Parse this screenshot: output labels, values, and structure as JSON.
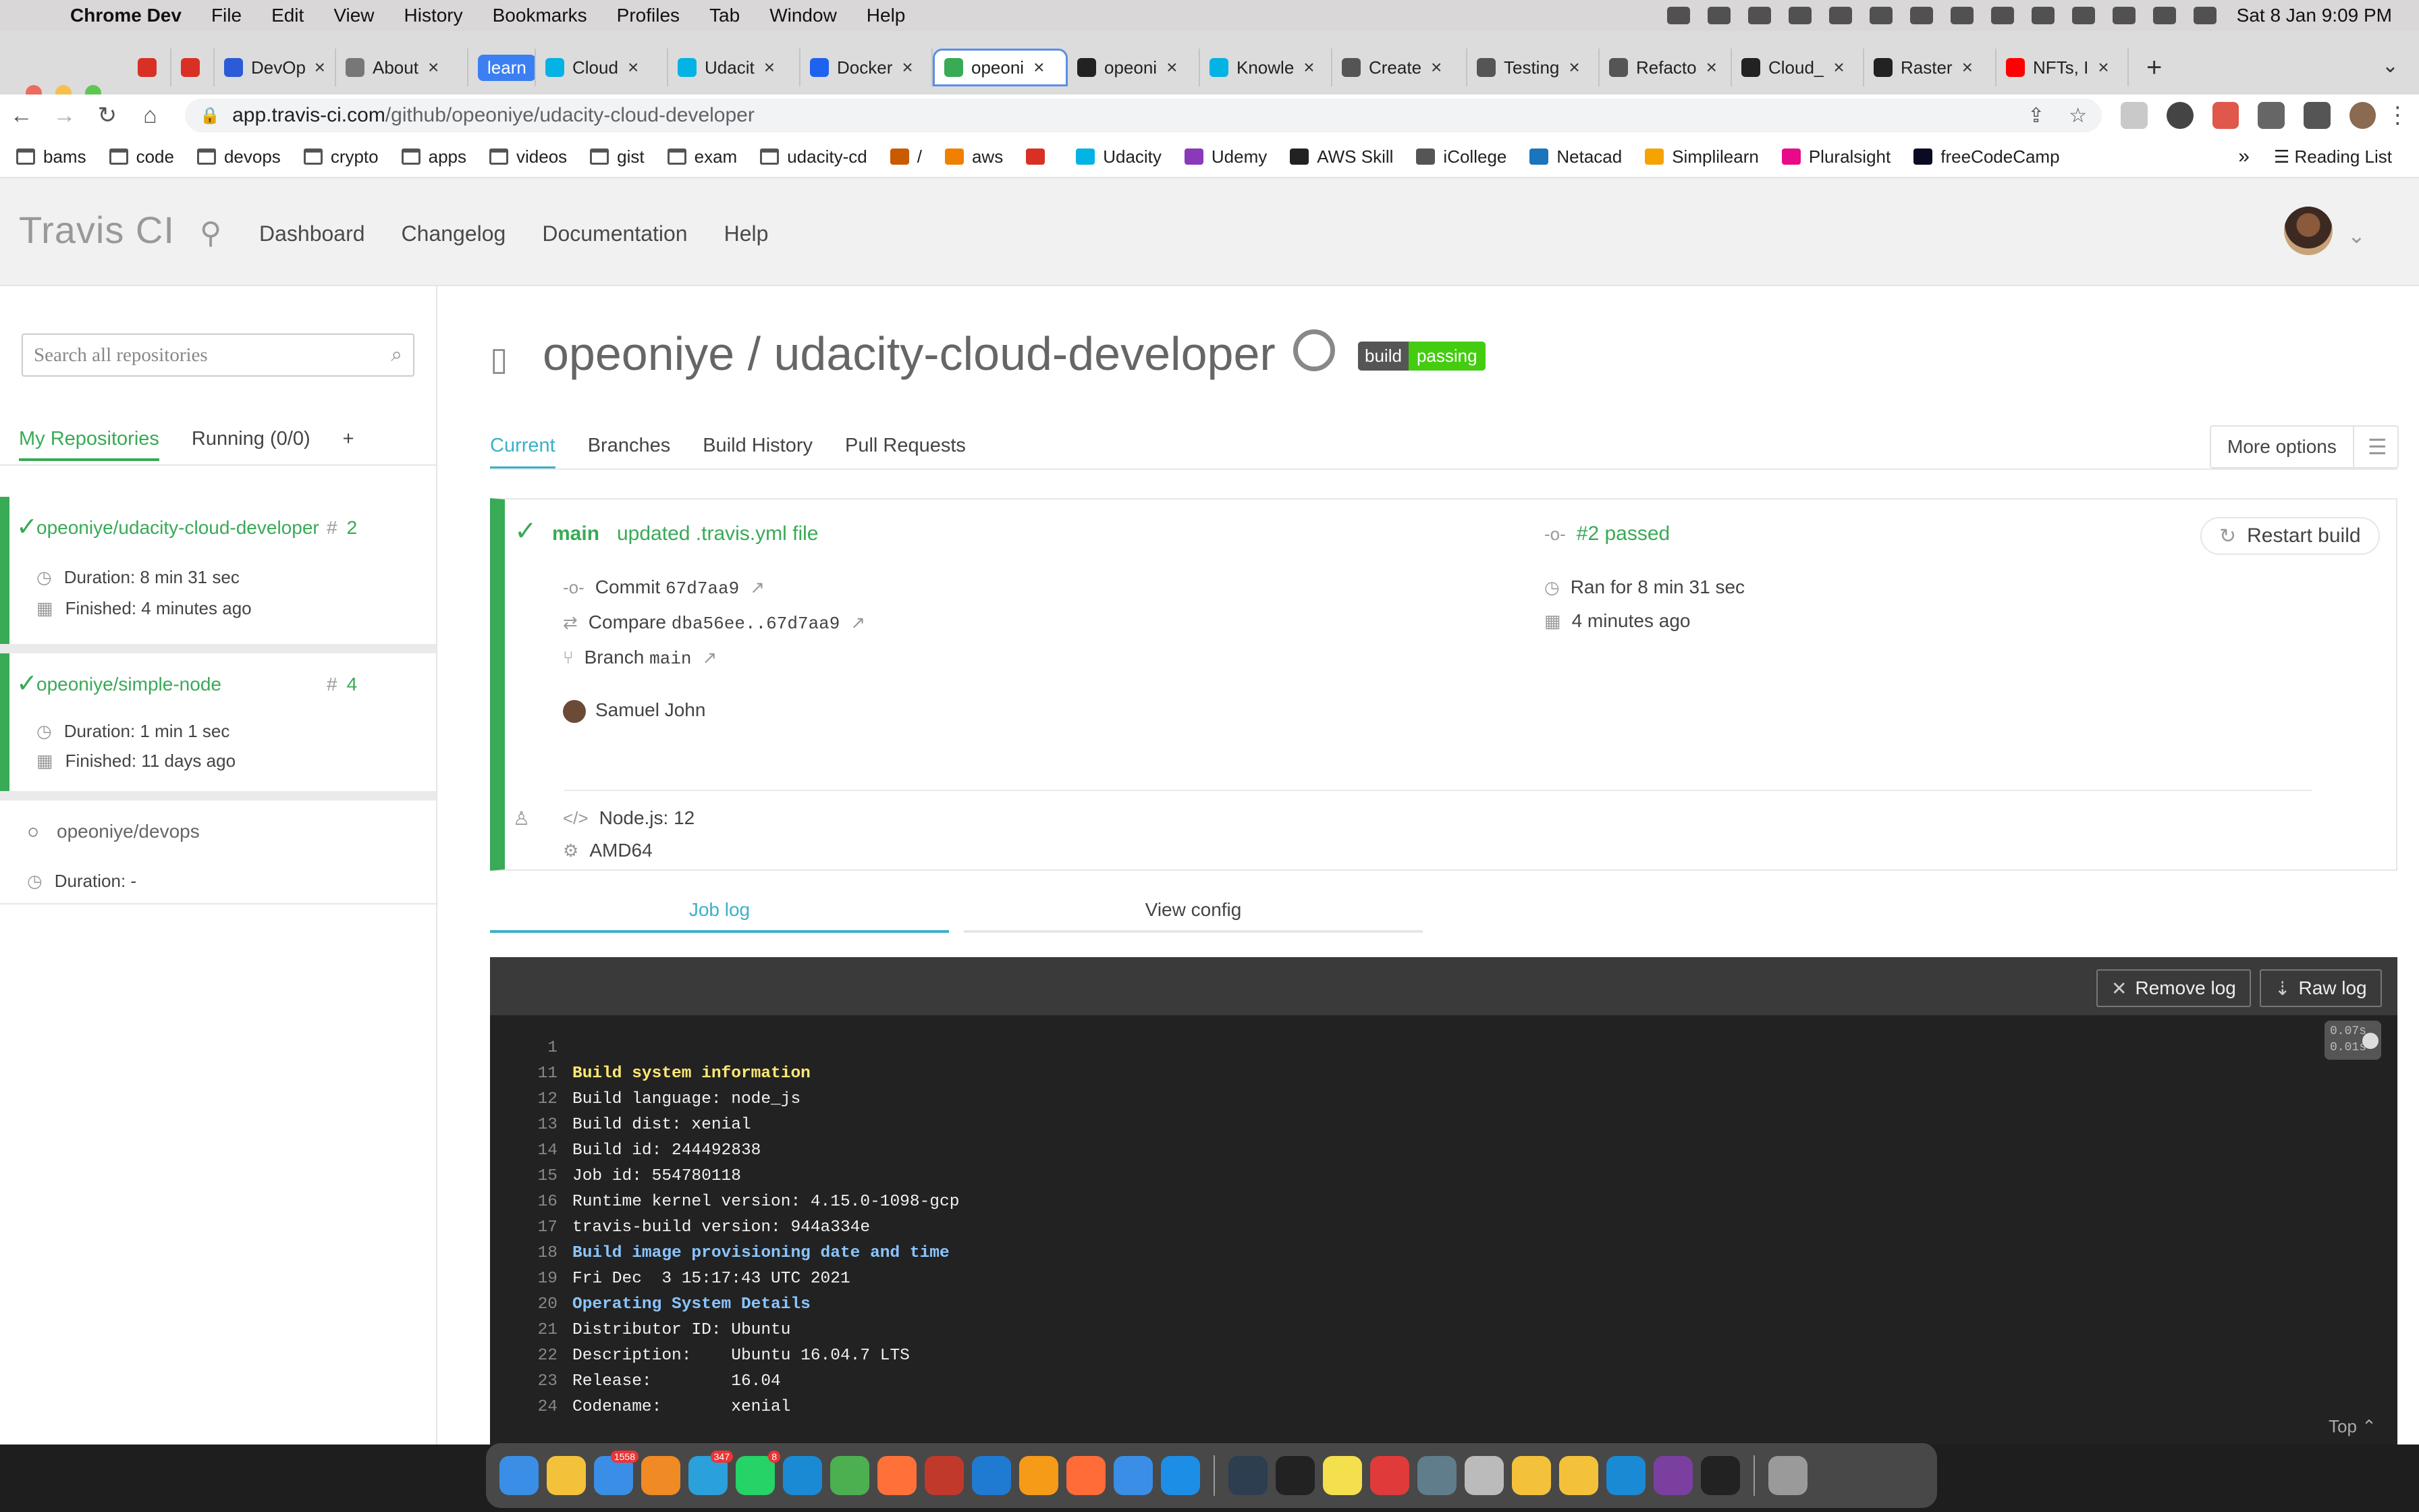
{
  "menubar": {
    "app_name": "Chrome Dev",
    "items": [
      "File",
      "Edit",
      "View",
      "History",
      "Bookmarks",
      "Profiles",
      "Tab",
      "Window",
      "Help"
    ],
    "clock": "Sat 8 Jan  9:09 PM",
    "status_icons": [
      "notes-icon",
      "evernote-icon",
      "upload-icon",
      "app-badge-icon",
      "docker-icon",
      "mail-icon",
      "reader-icon",
      "search-icon",
      "play-icon",
      "layout-icon",
      "headphones-icon",
      "wifi-icon",
      "battery-icon",
      "control-center-icon"
    ]
  },
  "tabs": [
    {
      "label": "",
      "icon": "gmail-icon",
      "color": "#d93025"
    },
    {
      "label": "",
      "icon": "gmail-icon",
      "color": "#d93025"
    },
    {
      "label": "DevOp",
      "icon": "azure-icon",
      "color": "#2b5bd7"
    },
    {
      "label": "About",
      "icon": "docker-icon",
      "color": "#777"
    },
    {
      "label": "learn",
      "icon": "",
      "color": "#3b7ff2"
    },
    {
      "label": "Cloud",
      "icon": "udacity-icon",
      "color": "#02b3e4"
    },
    {
      "label": "Udacit",
      "icon": "udacity-icon",
      "color": "#02b3e4"
    },
    {
      "label": "Docker",
      "icon": "docker-icon",
      "color": "#1d63ed"
    },
    {
      "label": "opeoni",
      "icon": "travis-icon",
      "color": "#39aa56",
      "active": true
    },
    {
      "label": "opeoni",
      "icon": "github-icon",
      "color": "#222"
    },
    {
      "label": "Knowle",
      "icon": "udacity-icon",
      "color": "#02b3e4"
    },
    {
      "label": "Create",
      "icon": "code-icon",
      "color": "#555"
    },
    {
      "label": "Testing",
      "icon": "chrome-icon",
      "color": "#555"
    },
    {
      "label": "Refacto",
      "icon": "chrome-icon",
      "color": "#555"
    },
    {
      "label": "Cloud_",
      "icon": "github-icon",
      "color": "#222"
    },
    {
      "label": "Raster",
      "icon": "github-icon",
      "color": "#222"
    },
    {
      "label": "NFTs, I",
      "icon": "youtube-icon",
      "color": "#ff0000"
    }
  ],
  "address": {
    "domain": "app.travis-ci.com",
    "path": "/github/opeoniye/udacity-cloud-developer"
  },
  "bookmarks": [
    {
      "label": "bams",
      "type": "folder"
    },
    {
      "label": "code",
      "type": "folder"
    },
    {
      "label": "devops",
      "type": "folder"
    },
    {
      "label": "crypto",
      "type": "folder"
    },
    {
      "label": "apps",
      "type": "folder"
    },
    {
      "label": "videos",
      "type": "folder"
    },
    {
      "label": "gist",
      "type": "folder"
    },
    {
      "label": "exam",
      "type": "folder"
    },
    {
      "label": "udacity-cd",
      "type": "folder"
    },
    {
      "label": "/",
      "type": "site",
      "color": "#c85a00"
    },
    {
      "label": "aws",
      "type": "site",
      "color": "#f08000"
    },
    {
      "label": "",
      "type": "site",
      "color": "#d93025"
    },
    {
      "label": "Udacity",
      "type": "site",
      "color": "#02b3e4"
    },
    {
      "label": "Udemy",
      "type": "site",
      "color": "#8a3ab9"
    },
    {
      "label": "AWS Skill",
      "type": "site",
      "color": "#222"
    },
    {
      "label": "iCollege",
      "type": "site",
      "color": "#555"
    },
    {
      "label": "Netacad",
      "type": "site",
      "color": "#1b75bc"
    },
    {
      "label": "Simplilearn",
      "type": "site",
      "color": "#f5a300"
    },
    {
      "label": "Pluralsight",
      "type": "site",
      "color": "#e80a89"
    },
    {
      "label": "freeCodeCamp",
      "type": "site",
      "color": "#0a0a23"
    }
  ],
  "bookmarks_more": "»",
  "reading_list": "Reading List",
  "travis": {
    "logo": "Travis CI",
    "nav": [
      "Dashboard",
      "Changelog",
      "Documentation",
      "Help"
    ],
    "search_placeholder": "Search all repositories",
    "sidebar_tabs": [
      "My Repositories",
      "Running (0/0)",
      "+"
    ],
    "repos": [
      {
        "name": "opeoniye/udacity-cloud-developer",
        "number": "2",
        "duration": "Duration: 8 min 31 sec",
        "finished": "Finished: 4 minutes ago",
        "status": "passed"
      },
      {
        "name": "opeoniye/simple-node",
        "number": "4",
        "duration": "Duration: 1 min 1 sec",
        "finished": "Finished: 11 days ago",
        "status": "passed"
      },
      {
        "name": "opeoniye/devops",
        "number": "",
        "duration": "Duration: -",
        "finished": "",
        "status": "none"
      }
    ],
    "repo_title": "opeoniye / udacity-cloud-developer",
    "badge": {
      "left": "build",
      "right": "passing"
    },
    "main_tabs": [
      "Current",
      "Branches",
      "Build History",
      "Pull Requests"
    ],
    "more_options": "More options",
    "build": {
      "branch": "main",
      "message": "updated .travis.yml file",
      "status": "#2 passed",
      "restart": "Restart build",
      "commit_label": "Commit",
      "commit": "67d7aa9",
      "compare_label": "Compare",
      "compare": "dba56ee..67d7aa9",
      "branch_label": "Branch",
      "branch_value": "main",
      "author": "Samuel John",
      "ran_for": "Ran for 8 min 31 sec",
      "ago": "4 minutes ago",
      "language": "Node.js: 12",
      "arch": "AMD64"
    },
    "log_tabs": [
      "Job log",
      "View config"
    ],
    "log_buttons": {
      "remove": "Remove log",
      "raw": "Raw log"
    },
    "timing": [
      "0.07s",
      "0.01s"
    ],
    "top_link": "Top",
    "log_lines": [
      {
        "n": "1",
        "t": "",
        "style": ""
      },
      {
        "n": "11",
        "t": "Build system information",
        "style": "yellow"
      },
      {
        "n": "12",
        "t": "Build language: node_js",
        "style": ""
      },
      {
        "n": "13",
        "t": "Build dist: xenial",
        "style": ""
      },
      {
        "n": "14",
        "t": "Build id: 244492838",
        "style": ""
      },
      {
        "n": "15",
        "t": "Job id: 554780118",
        "style": ""
      },
      {
        "n": "16",
        "t": "Runtime kernel version: 4.15.0-1098-gcp",
        "style": ""
      },
      {
        "n": "17",
        "t": "travis-build version: 944a334e",
        "style": ""
      },
      {
        "n": "18",
        "t": "Build image provisioning date and time",
        "style": "blue"
      },
      {
        "n": "19",
        "t": "Fri Dec  3 15:17:43 UTC 2021",
        "style": ""
      },
      {
        "n": "20",
        "t": "Operating System Details",
        "style": "blue"
      },
      {
        "n": "21",
        "t": "Distributor ID: Ubuntu",
        "style": ""
      },
      {
        "n": "22",
        "t": "Description:    Ubuntu 16.04.7 LTS",
        "style": ""
      },
      {
        "n": "23",
        "t": "Release:        16.04",
        "style": ""
      },
      {
        "n": "24",
        "t": "Codename:       xenial",
        "style": ""
      }
    ]
  },
  "dock": [
    {
      "icon": "finder-icon",
      "color": "#3a8ee6"
    },
    {
      "icon": "notes-icon",
      "color": "#f4c23a"
    },
    {
      "icon": "mail-icon",
      "color": "#3a8ee6",
      "count": "1558"
    },
    {
      "icon": "books-icon",
      "color": "#f08a24"
    },
    {
      "icon": "telegram-icon",
      "color": "#2aa1da",
      "count": "347"
    },
    {
      "icon": "whatsapp-icon",
      "color": "#25d366",
      "count": "8"
    },
    {
      "icon": "edge-icon",
      "color": "#1a8ad4"
    },
    {
      "icon": "chrome-icon",
      "color": "#4caf50"
    },
    {
      "icon": "firefox-icon",
      "color": "#ff7139"
    },
    {
      "icon": "chrome-dev-icon",
      "color": "#c0392b"
    },
    {
      "icon": "vscode-icon",
      "color": "#1f7ad2"
    },
    {
      "icon": "sublime-icon",
      "color": "#f59b18"
    },
    {
      "icon": "postman-icon",
      "color": "#ff6c37"
    },
    {
      "icon": "git-fork-icon",
      "color": "#3a8ee6"
    },
    {
      "icon": "docker-icon",
      "color": "#1d8ee6"
    },
    {
      "icon": "scanner-icon",
      "color": "#2c3e50"
    },
    {
      "icon": "terminal-icon",
      "color": "#222"
    },
    {
      "icon": "stickies-icon",
      "color": "#f4e04d"
    },
    {
      "icon": "acrobat-icon",
      "color": "#e03a3a"
    },
    {
      "icon": "tableplus-icon",
      "color": "#607d8b"
    },
    {
      "icon": "color-picker-icon",
      "color": "#bbb"
    },
    {
      "icon": "cyberduck-icon",
      "color": "#f4c23a"
    },
    {
      "icon": "notes-list-icon",
      "color": "#f4c23a"
    },
    {
      "icon": "app-store-icon",
      "color": "#1a8ad4"
    },
    {
      "icon": "onenote-icon",
      "color": "#7b3fa0"
    },
    {
      "icon": "binance-icon",
      "color": "#222"
    },
    {
      "icon": "trash-icon",
      "color": "#9a9a9a"
    }
  ]
}
